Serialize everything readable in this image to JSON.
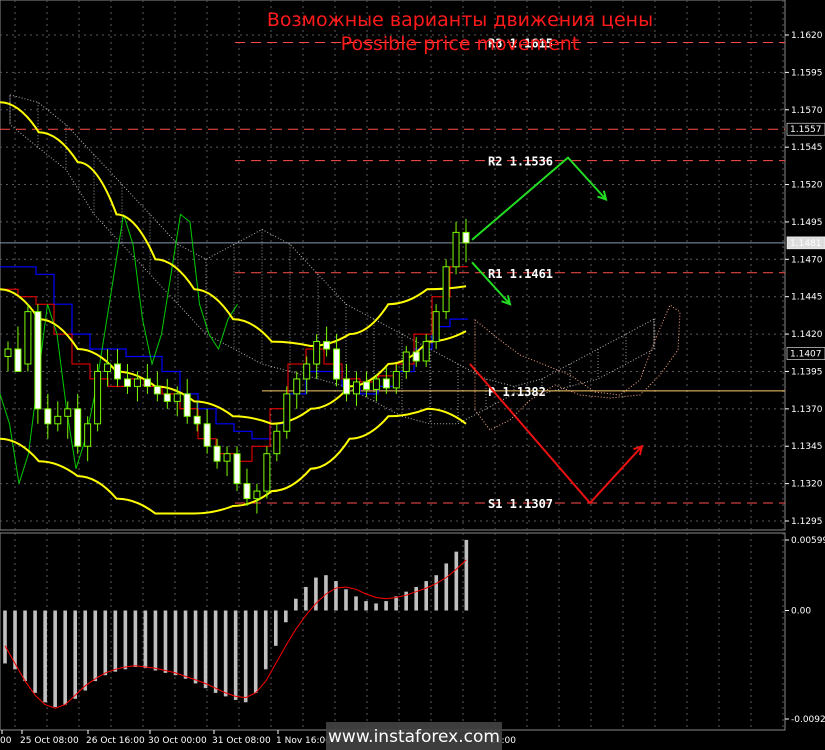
{
  "title_ru": "Возможные варианты движения цены",
  "title_en": "Possible price movement",
  "watermark": "www.instaforex.com",
  "colors": {
    "background": "#000000",
    "grid": "#5a5a5a",
    "candle_body": "#7CFC00",
    "candle_bull_fill": "#000000",
    "candle_bear_fill": "#ffffff",
    "bollinger": "#ffff00",
    "tenkan": "#ff0000",
    "kijun": "#0000ff",
    "chikou": "#00cc00",
    "cloud": "#ffffff",
    "level_line": "#ff4d4d",
    "pivot_line": "#ffcc66",
    "arrow_up": "#22dd22",
    "arrow_down": "#ee1111",
    "macd_hist": "#c0c0c0",
    "macd_signal": "#ff0000",
    "title": "#ff1a1a"
  },
  "chart_data": [
    {
      "type": "candlestick",
      "ylim": [
        1.2935,
        1.1645
      ],
      "y_ticks": [
        "1.1620",
        "1.1595",
        "1.1570",
        "1.1545",
        "1.1520",
        "1.1495",
        "1.1470",
        "1.1445",
        "1.1420",
        "1.1395",
        "1.1370",
        "1.1345",
        "1.1320",
        "1.1295"
      ],
      "price_tags": [
        {
          "label": "1.1557",
          "value": 1.1557
        },
        {
          "label": "1.1481",
          "value": 1.1481
        },
        {
          "label": "1.1407",
          "value": 1.1407
        }
      ],
      "levels": [
        {
          "name": "R3",
          "label": "R3  1.1615",
          "value": 1.1615
        },
        {
          "name": "R2",
          "label": "R2  1.1536",
          "value": 1.1536
        },
        {
          "name": "R1",
          "label": "R1  1.1461",
          "value": 1.1461
        },
        {
          "name": "P",
          "label": "P  1.1382",
          "value": 1.1382
        },
        {
          "name": "S1",
          "label": "S1  1.1307",
          "value": 1.1307
        }
      ],
      "dashed_extra_level": 1.1557,
      "x_labels": [
        "00",
        "25 Oct 08:00",
        "26 Oct 16:00",
        "30 Oct 00:00",
        "31 Oct 08:00",
        "1 Nov 16:00",
        "16:00"
      ],
      "candles": [
        [
          1.1405,
          1.1415,
          1.1395,
          1.141
        ],
        [
          1.141,
          1.1425,
          1.14,
          1.1395
        ],
        [
          1.14,
          1.144,
          1.1395,
          1.1435
        ],
        [
          1.1435,
          1.144,
          1.136,
          1.137
        ],
        [
          1.137,
          1.138,
          1.135,
          1.136
        ],
        [
          1.136,
          1.1375,
          1.1355,
          1.1365
        ],
        [
          1.1365,
          1.1375,
          1.135,
          1.137
        ],
        [
          1.137,
          1.138,
          1.134,
          1.1345
        ],
        [
          1.1345,
          1.1365,
          1.1335,
          1.136
        ],
        [
          1.136,
          1.14,
          1.1355,
          1.1395
        ],
        [
          1.1395,
          1.141,
          1.1385,
          1.14
        ],
        [
          1.14,
          1.141,
          1.1385,
          1.139
        ],
        [
          1.139,
          1.14,
          1.138,
          1.1385
        ],
        [
          1.1385,
          1.1395,
          1.1375,
          1.139
        ],
        [
          1.139,
          1.14,
          1.138,
          1.1385
        ],
        [
          1.1385,
          1.1395,
          1.1375,
          1.138
        ],
        [
          1.138,
          1.139,
          1.137,
          1.1375
        ],
        [
          1.1375,
          1.1385,
          1.1365,
          1.138
        ],
        [
          1.138,
          1.139,
          1.136,
          1.1365
        ],
        [
          1.1365,
          1.1375,
          1.1355,
          1.136
        ],
        [
          1.136,
          1.137,
          1.134,
          1.1345
        ],
        [
          1.1345,
          1.135,
          1.133,
          1.1335
        ],
        [
          1.1335,
          1.1345,
          1.1325,
          1.134
        ],
        [
          1.134,
          1.1345,
          1.1315,
          1.132
        ],
        [
          1.132,
          1.133,
          1.1305,
          1.131
        ],
        [
          1.131,
          1.132,
          1.13,
          1.1315
        ],
        [
          1.1315,
          1.1345,
          1.131,
          1.134
        ],
        [
          1.134,
          1.136,
          1.1335,
          1.1355
        ],
        [
          1.1355,
          1.1385,
          1.135,
          1.138
        ],
        [
          1.138,
          1.1395,
          1.137,
          1.139
        ],
        [
          1.139,
          1.1405,
          1.138,
          1.14
        ],
        [
          1.14,
          1.142,
          1.139,
          1.1415
        ],
        [
          1.1415,
          1.1425,
          1.1405,
          1.141
        ],
        [
          1.141,
          1.142,
          1.1385,
          1.139
        ],
        [
          1.139,
          1.14,
          1.1375,
          1.138
        ],
        [
          1.138,
          1.1395,
          1.1372,
          1.1388
        ],
        [
          1.1388,
          1.1395,
          1.1378,
          1.1383
        ],
        [
          1.1383,
          1.1393,
          1.1375,
          1.139
        ],
        [
          1.139,
          1.1398,
          1.138,
          1.1384
        ],
        [
          1.1384,
          1.14,
          1.138,
          1.1395
        ],
        [
          1.1395,
          1.1412,
          1.139,
          1.1408
        ],
        [
          1.1408,
          1.1418,
          1.1398,
          1.1402
        ],
        [
          1.1402,
          1.142,
          1.1398,
          1.1415
        ],
        [
          1.1415,
          1.144,
          1.141,
          1.1435
        ],
        [
          1.1435,
          1.147,
          1.143,
          1.1465
        ],
        [
          1.1465,
          1.1495,
          1.146,
          1.1488
        ],
        [
          1.1488,
          1.1497,
          1.1468,
          1.1481
        ]
      ],
      "bollinger": {
        "upper": [
          1.1575,
          1.1555,
          1.1535,
          1.15,
          1.147,
          1.145,
          1.143,
          1.1415,
          1.1412,
          1.142,
          1.144,
          1.145,
          1.1452
        ],
        "middle": [
          1.145,
          1.143,
          1.141,
          1.1395,
          1.1385,
          1.1375,
          1.1365,
          1.136,
          1.137,
          1.1385,
          1.14,
          1.1415,
          1.1422
        ],
        "lower": [
          1.135,
          1.1335,
          1.1325,
          1.131,
          1.13,
          1.13,
          1.1305,
          1.1315,
          1.133,
          1.135,
          1.1365,
          1.137,
          1.136
        ]
      },
      "arrows": [
        {
          "color": "up",
          "points": [
            [
              1.1483,
              0
            ],
            [
              1.1538,
              1
            ],
            [
              1.151,
              2
            ]
          ]
        },
        {
          "color": "up",
          "points": [
            [
              1.1468,
              0
            ],
            [
              1.144,
              1
            ]
          ]
        },
        {
          "color": "down",
          "points": [
            [
              1.14,
              0
            ],
            [
              1.1307,
              1
            ],
            [
              1.1345,
              2
            ]
          ]
        }
      ]
    },
    {
      "type": "bar",
      "name_is_printed": false,
      "ylim": [
        -0.00922,
        0.00599
      ],
      "y_ticks": [
        "0.00599",
        "0.00",
        "-0.00922"
      ],
      "histogram": [
        -0.0045,
        -0.005,
        -0.006,
        -0.007,
        -0.0078,
        -0.0082,
        -0.008,
        -0.0075,
        -0.0068,
        -0.006,
        -0.0055,
        -0.0052,
        -0.005,
        -0.0048,
        -0.0049,
        -0.0051,
        -0.0053,
        -0.0055,
        -0.0058,
        -0.0062,
        -0.0066,
        -0.007,
        -0.0073,
        -0.0076,
        -0.0078,
        -0.007,
        -0.005,
        -0.003,
        -0.001,
        0.001,
        0.002,
        0.0028,
        0.003,
        0.0025,
        0.0018,
        0.0012,
        0.0008,
        0.0006,
        0.0008,
        0.0012,
        0.0016,
        0.002,
        0.0025,
        0.003,
        0.004,
        0.005,
        0.006
      ],
      "signal": [
        -0.003,
        -0.0045,
        -0.006,
        -0.0072,
        -0.008,
        -0.0083,
        -0.008,
        -0.0072,
        -0.0064,
        -0.0058,
        -0.0053,
        -0.005,
        -0.0048,
        -0.0047,
        -0.0048,
        -0.0049,
        -0.0051,
        -0.0053,
        -0.0056,
        -0.0059,
        -0.0062,
        -0.0066,
        -0.007,
        -0.0073,
        -0.0074,
        -0.007,
        -0.006,
        -0.0045,
        -0.003,
        -0.0016,
        -0.0004,
        0.0006,
        0.0014,
        0.0019,
        0.002,
        0.0018,
        0.0014,
        0.0011,
        0.001,
        0.0011,
        0.0013,
        0.0016,
        0.0019,
        0.0023,
        0.0028,
        0.0035,
        0.0043
      ]
    }
  ]
}
